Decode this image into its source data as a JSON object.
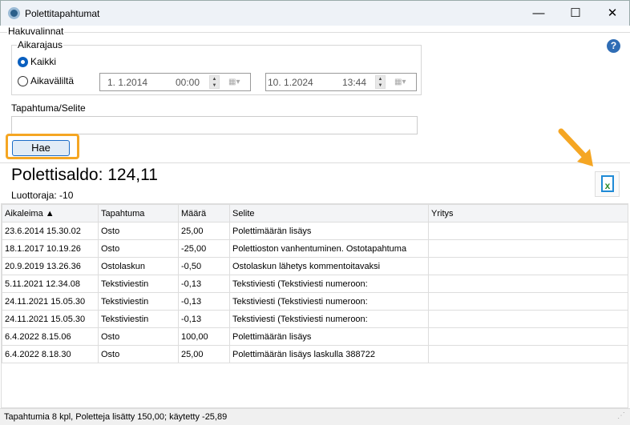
{
  "window": {
    "title": "Polettitapahtumat",
    "minimize": "—",
    "maximize": "☐",
    "close": "✕"
  },
  "search": {
    "group_label": "Hakuvalinnat",
    "time_group_label": "Aikarajaus",
    "option_all": "Kaikki",
    "option_range": "Aikaväliltä",
    "selected": "Kaikki",
    "from_date": "1.  1.2014",
    "from_time": "00:00",
    "to_date": "10.  1.2024",
    "to_time": "13:44",
    "filter_label": "Tapahtuma/Selite",
    "filter_value": "",
    "search_button": "Hae"
  },
  "summary": {
    "balance": "Polettisaldo: 124,11",
    "credit_limit": "Luottoraja: -10"
  },
  "table": {
    "columns": [
      "Aikaleima ▲",
      "Tapahtuma",
      "Määrä",
      "Selite",
      "Yritys"
    ],
    "rows": [
      [
        "23.6.2014 15.30.02",
        "Osto",
        "25,00",
        "Polettimäärän lisäys",
        ""
      ],
      [
        "18.1.2017 10.19.26",
        "Osto",
        "-25,00",
        "Polettioston vanhentuminen. Ostotapahtuma",
        ""
      ],
      [
        "20.9.2019 13.26.36",
        "Ostolaskun",
        "-0,50",
        "Ostolaskun lähetys kommentoitavaksi",
        ""
      ],
      [
        "5.11.2021 12.34.08",
        "Tekstiviestin",
        "-0,13",
        "Tekstiviesti (Tekstiviesti numeroon:",
        ""
      ],
      [
        "24.11.2021 15.05.30",
        "Tekstiviestin",
        "-0,13",
        "Tekstiviesti (Tekstiviesti numeroon:",
        ""
      ],
      [
        "24.11.2021 15.05.30",
        "Tekstiviestin",
        "-0,13",
        "Tekstiviesti (Tekstiviesti numeroon:",
        ""
      ],
      [
        "6.4.2022 8.15.06",
        "Osto",
        "100,00",
        "Polettimäärän lisäys",
        ""
      ],
      [
        "6.4.2022 8.18.30",
        "Osto",
        "25,00",
        "Polettimäärän lisäys laskulla 388722",
        ""
      ]
    ]
  },
  "status": {
    "text": "Tapahtumia 8 kpl, Poletteja lisätty 150,00; käytetty -25,89"
  },
  "icons": {
    "help": "help-icon",
    "export": "excel-export-icon",
    "annotation": "arrow-annotation"
  },
  "colors": {
    "highlight": "#f5a623",
    "accent": "#0a5fbf",
    "excel": "#2e8b2e"
  }
}
